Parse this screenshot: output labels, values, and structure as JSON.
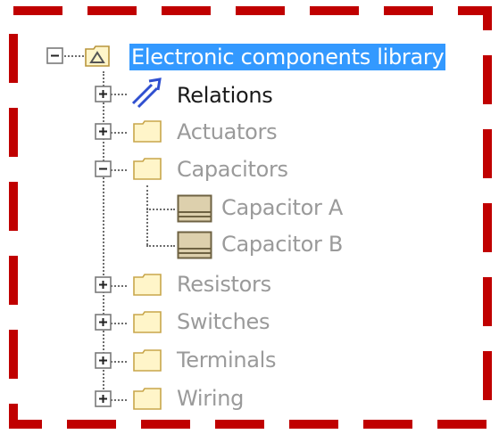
{
  "tree": {
    "root": {
      "label": "Electronic components library",
      "icon": "model-package-icon",
      "expanded": true,
      "selected": true
    },
    "children": [
      {
        "label": "Relations",
        "icon": "relations-icon",
        "expanded": false,
        "style": "dark"
      },
      {
        "label": "Actuators",
        "icon": "folder-icon",
        "expanded": false,
        "style": "muted"
      },
      {
        "label": "Capacitors",
        "icon": "folder-icon",
        "expanded": true,
        "style": "muted",
        "children": [
          {
            "label": "Capacitor A",
            "icon": "capacitor-block-icon"
          },
          {
            "label": "Capacitor B",
            "icon": "capacitor-block-icon"
          }
        ]
      },
      {
        "label": "Resistors",
        "icon": "folder-icon",
        "expanded": false,
        "style": "muted"
      },
      {
        "label": "Switches",
        "icon": "folder-icon",
        "expanded": false,
        "style": "muted"
      },
      {
        "label": "Terminals",
        "icon": "folder-icon",
        "expanded": false,
        "style": "muted"
      },
      {
        "label": "Wiring",
        "icon": "folder-icon",
        "expanded": false,
        "style": "muted"
      }
    ]
  },
  "colors": {
    "selection": "#3399ff",
    "frame_dash": "#c00000",
    "folder_fill": "#fff5c9",
    "folder_stroke": "#c8a64b",
    "relations_stroke": "#3050d0",
    "block_fill": "#d8c9a3"
  }
}
